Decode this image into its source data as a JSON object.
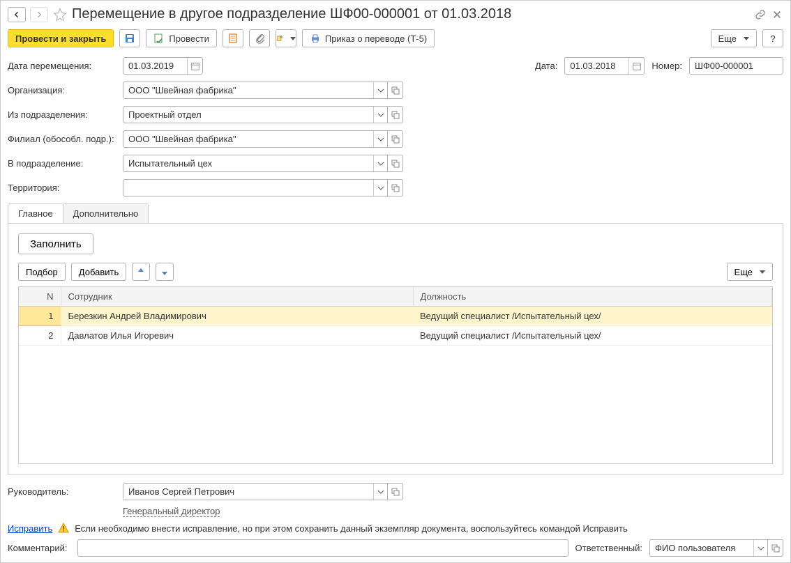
{
  "header": {
    "title": "Перемещение в другое подразделение ШФ00-000001 от 01.03.2018"
  },
  "toolbar": {
    "post_close": "Провести и закрыть",
    "post": "Провести",
    "print_order": "Приказ о переводе (Т-5)",
    "more": "Еще",
    "help": "?"
  },
  "form": {
    "move_date_label": "Дата перемещения:",
    "move_date": "01.03.2019",
    "date_label": "Дата:",
    "date": "01.03.2018",
    "number_label": "Номер:",
    "number": "ШФ00-000001",
    "org_label": "Организация:",
    "org": "ООО \"Швейная фабрика\"",
    "from_dept_label": "Из подразделения:",
    "from_dept": "Проектный отдел",
    "branch_label": "Филиал (обособл. подр.):",
    "branch": "ООО \"Швейная фабрика\"",
    "to_dept_label": "В подразделение:",
    "to_dept": "Испытательный цех",
    "territory_label": "Территория:",
    "territory": ""
  },
  "tabs": {
    "main": "Главное",
    "extra": "Дополнительно"
  },
  "tab_main": {
    "fill": "Заполнить",
    "select": "Подбор",
    "add": "Добавить",
    "more": "Еще"
  },
  "table": {
    "col_n": "N",
    "col_emp": "Сотрудник",
    "col_pos": "Должность",
    "rows": [
      {
        "n": "1",
        "emp": "Березкин Андрей Владимирович",
        "pos": "Ведущий специалист /Испытательный цех/"
      },
      {
        "n": "2",
        "emp": "Давлатов Илья Игоревич",
        "pos": "Ведущий специалист /Испытательный цех/"
      }
    ]
  },
  "bottom": {
    "manager_label": "Руководитель:",
    "manager": "Иванов Сергей Петрович",
    "manager_pos": "Генеральный директор",
    "fix_link": "Исправить",
    "hint": "Если необходимо внести исправление, но при этом сохранить данный экземпляр документа, воспользуйтесь командой Исправить",
    "comment_label": "Комментарий:",
    "comment": "",
    "resp_label": "Ответственный:",
    "resp": "ФИО пользователя"
  }
}
